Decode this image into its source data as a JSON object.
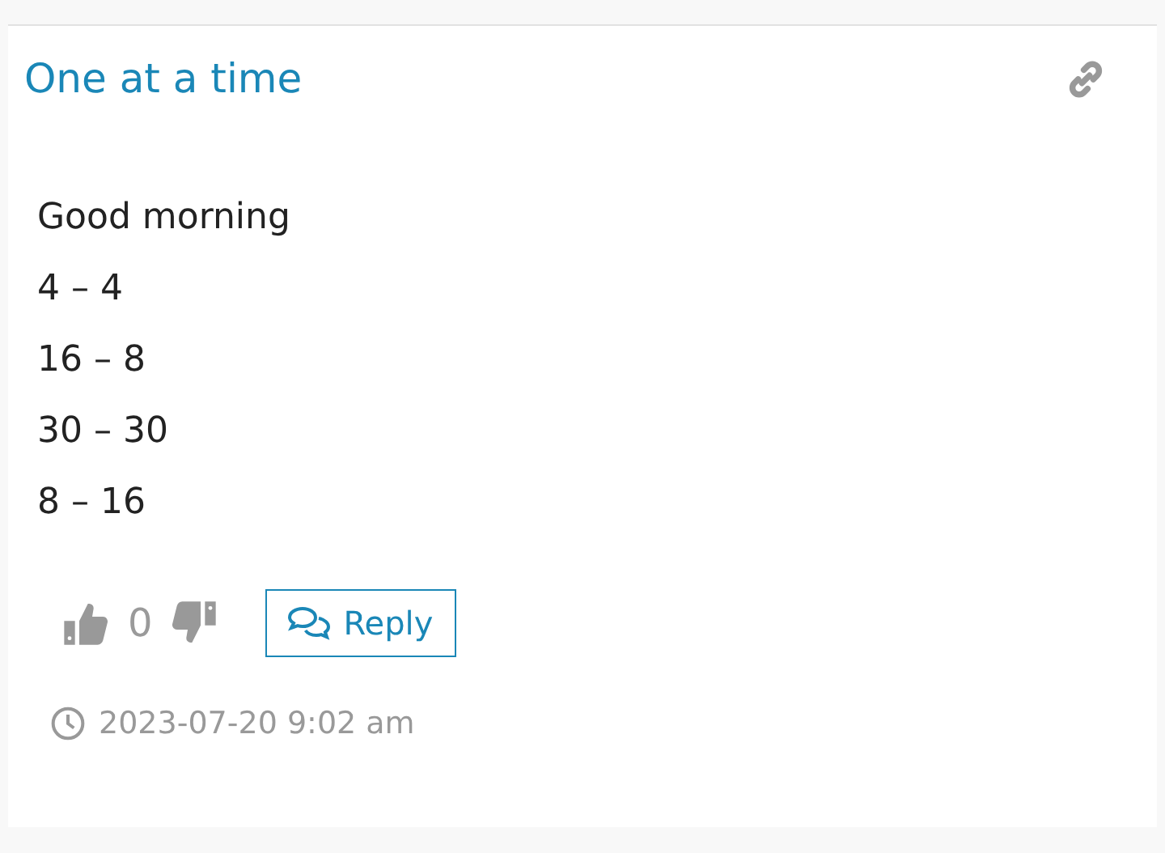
{
  "post": {
    "title": "One at a time",
    "lines": [
      "Good morning",
      "4 – 4",
      "16 – 8",
      "30 – 30",
      "8 – 16"
    ],
    "votes": "0",
    "reply_button": "Reply",
    "timestamp": "2023-07-20 9:02 am"
  }
}
